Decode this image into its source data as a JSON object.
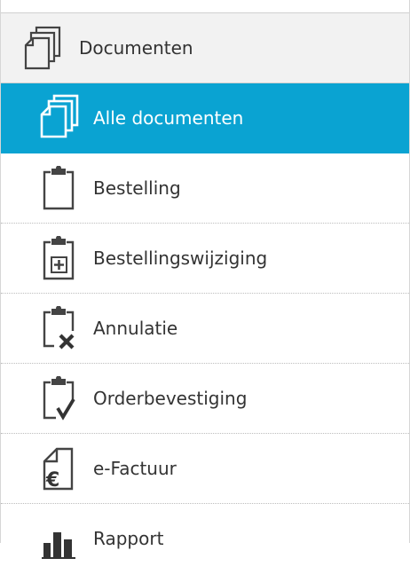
{
  "header": {
    "title": "Documenten",
    "icon": "documents-stack-icon"
  },
  "menu": {
    "active_color": "#0aa3d2",
    "items": [
      {
        "label": "Alle documenten",
        "icon": "documents-stack-icon",
        "active": true
      },
      {
        "label": "Bestelling",
        "icon": "clipboard-icon"
      },
      {
        "label": "Bestellingswijziging",
        "icon": "clipboard-plus-icon"
      },
      {
        "label": "Annulatie",
        "icon": "clipboard-x-icon"
      },
      {
        "label": "Orderbevestiging",
        "icon": "clipboard-check-icon"
      },
      {
        "label": "e-Factuur",
        "icon": "euro-document-icon"
      },
      {
        "label": "Rapport",
        "icon": "bar-chart-icon"
      }
    ]
  }
}
